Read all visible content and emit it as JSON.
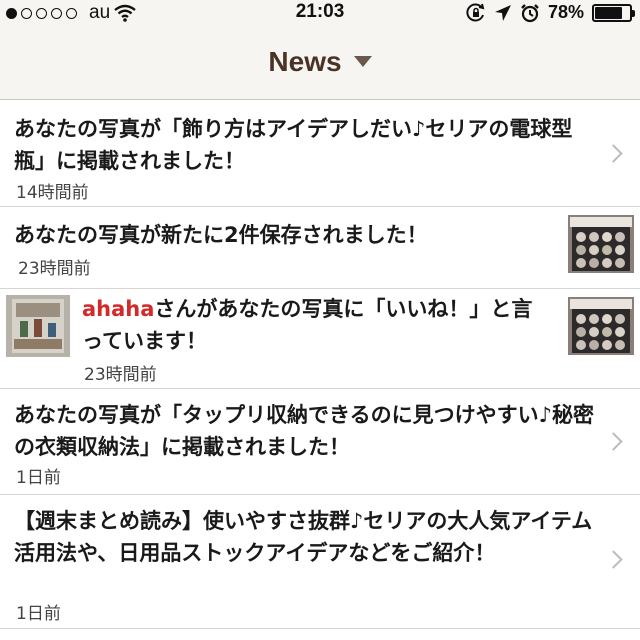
{
  "status_bar": {
    "carrier": "au",
    "time": "21:03",
    "battery": "78%",
    "battery_level": 0.78,
    "signal_bars_filled": 1,
    "signal_bars_total": 5,
    "icons": [
      "wifi-icon",
      "rotation-lock-icon",
      "location-arrow-icon",
      "alarm-icon",
      "battery-icon"
    ]
  },
  "nav": {
    "title": "News",
    "dropdown_icon": "caret-down-icon"
  },
  "notifications": [
    {
      "message": "あなたの写真が「飾り方はアイデアしだい♪セリアの電球型瓶」に掲載されました！",
      "time": "14時間前",
      "chevron": true
    },
    {
      "message": "あなたの写真が新たに2件保存されました！",
      "time": "23時間前",
      "thumbnail": "storage-photo"
    },
    {
      "user": "ahaha",
      "message": "さんがあなたの写真に「いいね！」と言っています！",
      "time": "23時間前",
      "avatar": "user-avatar",
      "thumbnail": "storage-photo"
    },
    {
      "message": "あなたの写真が「タップリ収納できるのに見つけやすい♪秘密の衣類収納法」に掲載されました！",
      "time": "1日前",
      "chevron": true
    },
    {
      "message": "【週末まとめ読み】使いやすさ抜群♪セリアの大人気アイテム活用法や、日用品ストックアイデアなどをご紹介！",
      "time": "1日前",
      "chevron": true
    }
  ],
  "colors": {
    "bar_background": "#f7f5f2",
    "title": "#4a3325",
    "username": "#d22a2a",
    "chevron": "#bcbcbc",
    "divider": "#d9d5d0"
  }
}
